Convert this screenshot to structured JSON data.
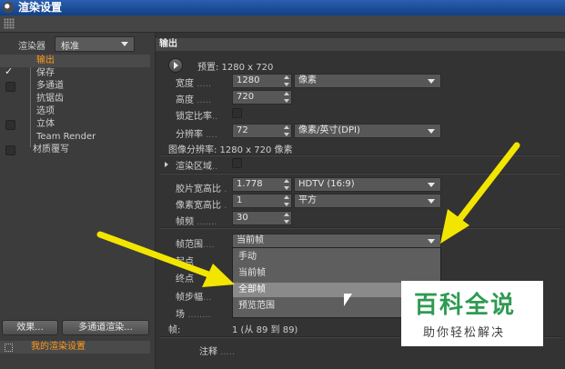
{
  "window": {
    "title": "渲染设置"
  },
  "left_panel": {
    "renderer_label": "渲染器",
    "renderer_value": "标准",
    "nav_items": [
      {
        "label": "输出",
        "active": true,
        "checked": false,
        "has_checkbox": false
      },
      {
        "label": "保存",
        "active": false,
        "checked": true,
        "has_checkbox": true
      },
      {
        "label": "多通道",
        "active": false,
        "checked": false,
        "has_checkbox": true
      },
      {
        "label": "抗锯齿",
        "active": false,
        "checked": false,
        "has_checkbox": false
      },
      {
        "label": "选项",
        "active": false,
        "checked": false,
        "has_checkbox": false
      },
      {
        "label": "立体",
        "active": false,
        "checked": false,
        "has_checkbox": true
      },
      {
        "label": "Team Render",
        "active": false,
        "checked": false,
        "has_checkbox": false
      },
      {
        "label": "材质覆写",
        "active": false,
        "checked": false,
        "has_checkbox": true
      }
    ],
    "effects_button": "效果...",
    "multipass_button": "多通道渲染...",
    "preset_label": "我的渲染设置"
  },
  "output": {
    "header": "输出",
    "preset": "预置: 1280 x 720",
    "width_label": "宽度",
    "width_value": "1280",
    "width_unit": "像素",
    "height_label": "高度",
    "height_value": "720",
    "lock_ratio_label": "锁定比率",
    "resolution_label": "分辨率",
    "resolution_value": "72",
    "resolution_unit": "像素/英寸(DPI)",
    "image_resolution": "图像分辨率: 1280 x 720 像素",
    "render_region_label": "渲染区域",
    "film_ratio_label": "胶片宽高比",
    "film_ratio_value": "1.778",
    "film_ratio_preset": "HDTV (16:9)",
    "pixel_ratio_label": "像素宽高比",
    "pixel_ratio_value": "1",
    "pixel_ratio_preset": "平方",
    "frame_rate_label": "帧频",
    "frame_rate_value": "30",
    "frame_range_label": "帧范围",
    "frame_range_value": "当前帧",
    "frame_range_options": [
      "手动",
      "当前帧",
      "全部帧",
      "预览范围"
    ],
    "frame_range_highlighted": 2,
    "start_label": "起点",
    "end_label": "终点",
    "frame_step_label": "帧步幅",
    "field_label": "场",
    "frames_label": "帧:",
    "frames_value": "1 (从 89 到 89)",
    "notes_label": "注释"
  },
  "watermark": {
    "title": "百科全说",
    "subtitle": "助你轻松解决"
  },
  "colors": {
    "title_bar": "#1e4f9c",
    "active_item": "#ff9a1a",
    "arrow": "#f2e600",
    "watermark_green": "#2f9a52"
  }
}
